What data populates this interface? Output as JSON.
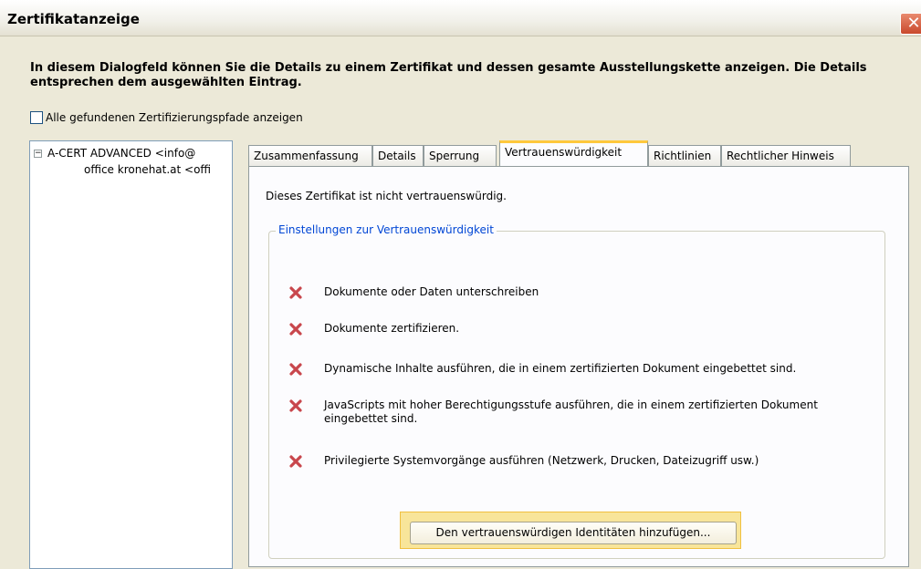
{
  "window": {
    "title": "Zertifikatanzeige",
    "close_glyph": "✕"
  },
  "intro_text": "In diesem Dialogfeld können Sie die Details zu einem Zertifikat und dessen gesamte Ausstellungskette anzeigen. Die Details entsprechen dem ausgewählten Eintrag.",
  "show_all_paths": {
    "label": "Alle gefundenen Zertifizierungspfade anzeigen",
    "checked": false
  },
  "tree": {
    "expander_glyph": "−",
    "items": [
      {
        "label": "A-CERT ADVANCED <info@"
      },
      {
        "label": "office kronehat.at <offi"
      }
    ]
  },
  "tabs": [
    {
      "label": "Zusammenfassung"
    },
    {
      "label": "Details"
    },
    {
      "label": "Sperrung"
    },
    {
      "label": "Vertrauenswürdigkeit",
      "active": true
    },
    {
      "label": "Richtlinien"
    },
    {
      "label": "Rechtlicher Hinweis"
    }
  ],
  "trust": {
    "status": "Dieses Zertifikat ist nicht vertrauenswürdig.",
    "group_title": "Einstellungen zur Vertrauenswürdigkeit",
    "denied_icon": "red-x-icon",
    "items": [
      {
        "text": "Dokumente oder Daten unterschreiben"
      },
      {
        "text": "Dokumente zertifizieren."
      },
      {
        "text": "Dynamische Inhalte ausführen, die in einem zertifizierten Dokument eingebettet sind."
      },
      {
        "text": "JavaScripts mit hoher Berechtigungsstufe ausführen, die in einem zertifizierten Dokument eingebettet sind."
      },
      {
        "text": "Privilegierte Systemvorgänge ausführen (Netzwerk, Drucken, Dateizugriff usw.)"
      }
    ],
    "add_button_label": "Den vertrauenswürdigen Identitäten hinzufügen..."
  },
  "colors": {
    "dialog_bg": "#ece9d8",
    "active_tab_accent": "#ffc83c",
    "group_title": "#0046d5",
    "deny_icon": "#c8464c",
    "highlight": "#f8e59a"
  }
}
